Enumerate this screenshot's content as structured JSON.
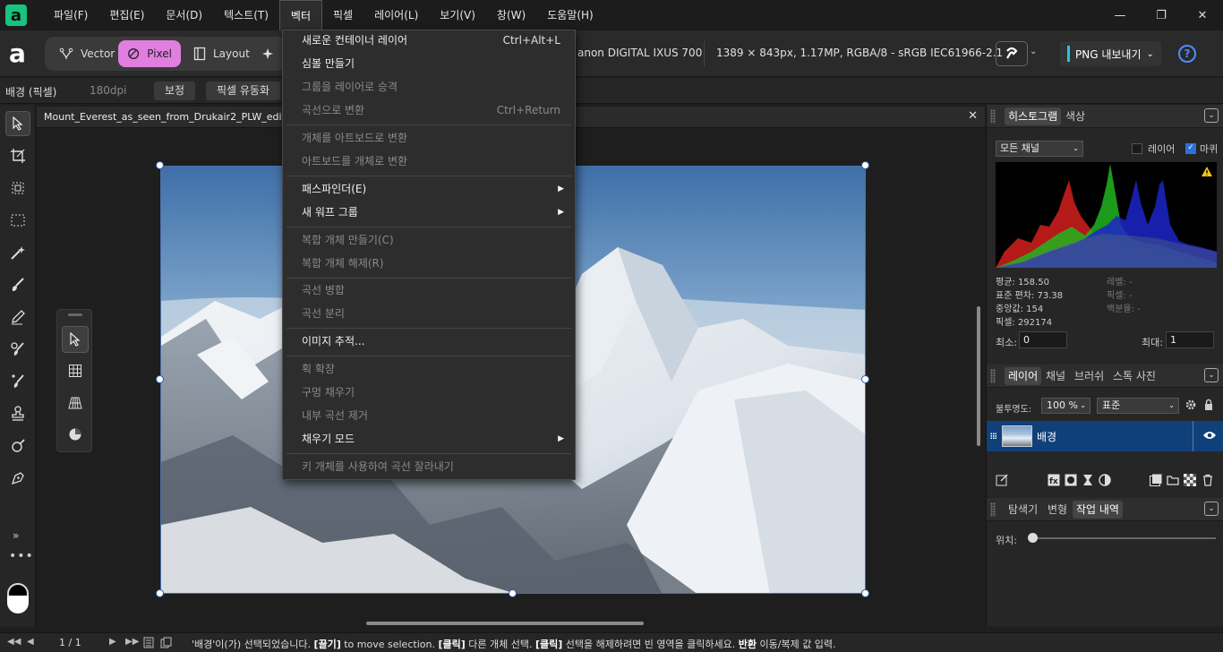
{
  "menubar": {
    "logo": "a",
    "items": [
      "파일(F)",
      "편집(E)",
      "문서(D)",
      "텍스트(T)",
      "벡터",
      "픽셀",
      "레이어(L)",
      "보기(V)",
      "창(W)",
      "도움말(H)"
    ],
    "active_index": 4
  },
  "window_controls": {
    "minimize": "—",
    "restore": "❐",
    "close": "✕"
  },
  "toolbar": {
    "brand": "a",
    "personas": [
      "Vector",
      "Pixel",
      "Layout"
    ],
    "active_persona": "Pixel",
    "camera_info": "anon DIGITAL IXUS 700",
    "image_info": "1389 × 843px, 1.17MP, RGBA/8 - sRGB IEC61966-2.1",
    "export_label": "PNG 내보내기",
    "help": "?"
  },
  "contextbar": {
    "layer_label": "배경 (픽셀)",
    "dpi": "180dpi",
    "adjust_btn": "보정",
    "liquify_btn": "픽셀 유동화"
  },
  "document": {
    "title": "Mount_Everest_as_seen_from_Drukair2_PLW_edit_Crop",
    "close": "✕"
  },
  "vector_menu": {
    "items": [
      {
        "label": "새로운 컨테이너 레이어",
        "shortcut": "Ctrl+Alt+L",
        "enabled": true
      },
      {
        "label": "심볼 만들기",
        "shortcut": "",
        "enabled": true
      },
      {
        "label": "그룹을 레이어로 승격",
        "shortcut": "",
        "enabled": false
      },
      {
        "label": "곡선으로 변환",
        "shortcut": "Ctrl+Return",
        "enabled": false
      },
      {
        "sep": true
      },
      {
        "label": "개체를 아트보드로 변환",
        "shortcut": "",
        "enabled": false
      },
      {
        "label": "아트보드를 개체로 변환",
        "shortcut": "",
        "enabled": false
      },
      {
        "sep": true
      },
      {
        "label": "패스파인더(E)",
        "submenu": true,
        "enabled": true
      },
      {
        "label": "새 워프 그룹",
        "submenu": true,
        "enabled": true
      },
      {
        "sep": true
      },
      {
        "label": "복합 개체 만들기(C)",
        "shortcut": "",
        "enabled": false
      },
      {
        "label": "복합 개체 해제(R)",
        "shortcut": "",
        "enabled": false
      },
      {
        "sep": true
      },
      {
        "label": "곡선 병합",
        "shortcut": "",
        "enabled": false
      },
      {
        "label": "곡선 분리",
        "shortcut": "",
        "enabled": false
      },
      {
        "sep": true
      },
      {
        "label": "이미지 추적...",
        "shortcut": "",
        "enabled": true
      },
      {
        "sep": true
      },
      {
        "label": "획 확장",
        "shortcut": "",
        "enabled": false
      },
      {
        "label": "구멍 채우기",
        "shortcut": "",
        "enabled": false
      },
      {
        "label": "내부 곡선 제거",
        "shortcut": "",
        "enabled": false
      },
      {
        "label": "채우기 모드",
        "submenu": true,
        "enabled": true
      },
      {
        "sep": true
      },
      {
        "label": "키 개체를 사용하여 곡선 잘라내기",
        "shortcut": "",
        "enabled": false
      }
    ]
  },
  "histogram_panel": {
    "tabs": [
      "히스토그램",
      "색상"
    ],
    "channel": "모든 채널",
    "layer_label": "레이어",
    "marquee_label": "마퀴",
    "mean": "평균: 158.50",
    "std": "표준 편차: 73.38",
    "median": "중앙값: 154",
    "pixels": "픽셀: 292174",
    "level": "레벨: -",
    "pixel_r": "픽셀: -",
    "percentile": "백분율: -",
    "min_label": "최소:",
    "min_value": "0",
    "max_label": "최대:",
    "max_value": "1"
  },
  "layers_panel": {
    "tabs": [
      "레이어",
      "채널",
      "브러쉬",
      "스톡 사진"
    ],
    "opacity_label": "불투명도:",
    "opacity_value": "100 %",
    "blend_mode": "표준",
    "layer_name": "배경"
  },
  "history_panel": {
    "tabs": [
      "탐색기",
      "변형",
      "작업 내역"
    ],
    "position_label": "위치:"
  },
  "statusbar": {
    "page": "1 / 1",
    "msg_1": "'배경'이(가) 선택되었습니다. ",
    "b_1": "[끌기]",
    "msg_2": " to move selection. ",
    "b_2": "[클릭]",
    "msg_3": " 다른 개체 선택. ",
    "b_3": "[클릭]",
    "msg_4": " 선택을 해제하려면 빈 영역을 클릭하세요. ",
    "b_4": "반환",
    "msg_5": " 이동/복제 값 입력."
  },
  "colors": {
    "accent_pixel": "#e07fe0",
    "selected_layer": "#10407a",
    "export_accent": "#1ec8e0",
    "app_green": "#19c37d"
  }
}
